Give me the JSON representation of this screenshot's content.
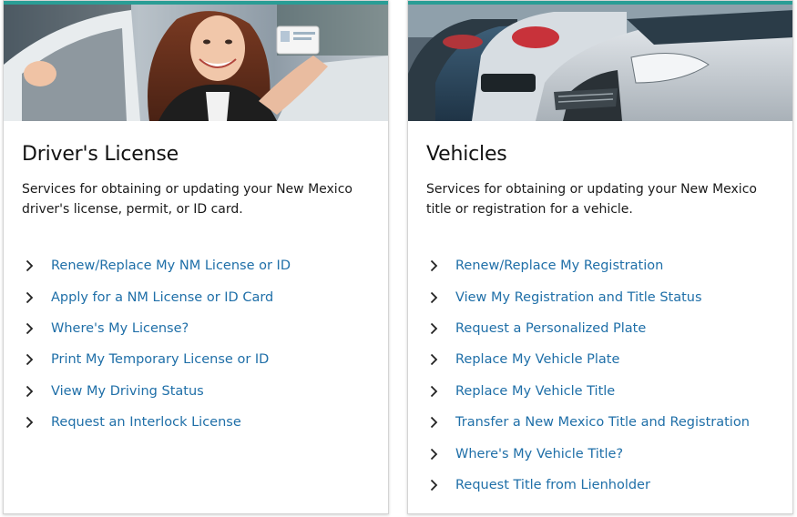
{
  "colors": {
    "accent": "#2a9d95",
    "link": "#1f6fa8",
    "title": "#111111"
  },
  "cards": [
    {
      "image_description_icon": "photo-woman-holding-license-in-car",
      "title": "Driver's License",
      "description": "Services for obtaining or updating your New Mexico driver's license, permit, or ID card.",
      "links": [
        {
          "label": "Renew/Replace My NM License or ID"
        },
        {
          "label": "Apply for a NM License or ID Card"
        },
        {
          "label": "Where's My License?"
        },
        {
          "label": "Print My Temporary License or ID"
        },
        {
          "label": "View My Driving Status"
        },
        {
          "label": "Request an Interlock License"
        }
      ]
    },
    {
      "image_description_icon": "photo-parked-cars",
      "title": "Vehicles",
      "description": "Services for obtaining or updating your New Mexico title or registration for a vehicle.",
      "links": [
        {
          "label": "Renew/Replace My Registration"
        },
        {
          "label": "View My Registration and Title Status"
        },
        {
          "label": "Request a Personalized Plate"
        },
        {
          "label": "Replace My Vehicle Plate"
        },
        {
          "label": "Replace My Vehicle Title"
        },
        {
          "label": "Transfer a New Mexico Title and Registration"
        },
        {
          "label": "Where's My Vehicle Title?"
        },
        {
          "label": "Request Title from Lienholder"
        }
      ]
    }
  ]
}
